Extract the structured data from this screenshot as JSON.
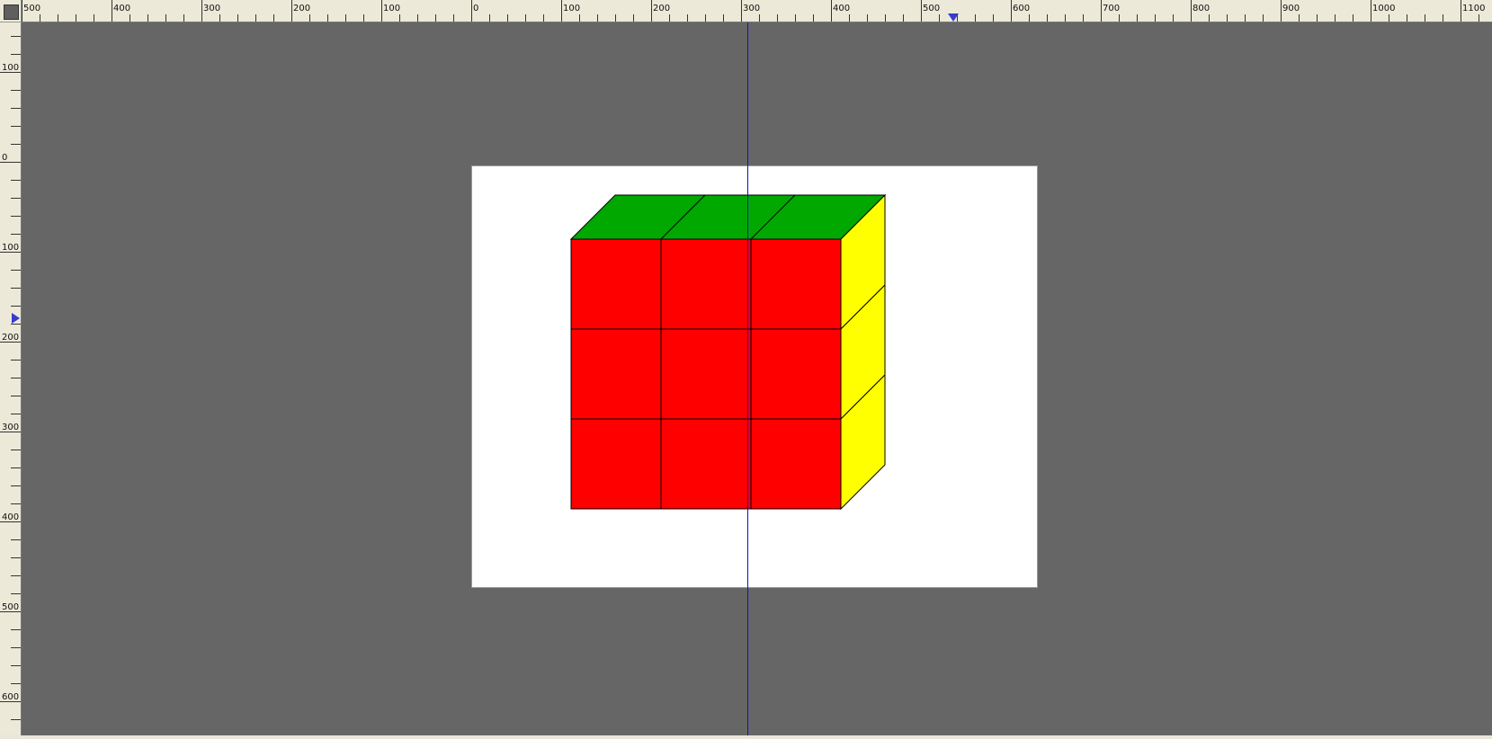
{
  "rulers": {
    "horizontal_labels": [
      "500",
      "400",
      "300",
      "200",
      "100",
      "0",
      "100",
      "200",
      "300",
      "400",
      "500",
      "600",
      "700",
      "800",
      "900",
      "1000",
      "1100"
    ],
    "vertical_labels": [
      "100",
      "0",
      "100",
      "200",
      "300",
      "400",
      "500",
      "600"
    ]
  },
  "cube": {
    "front_color": "#ff0000",
    "top_color": "#00a800",
    "side_color": "#ffff00",
    "edge_color": "#000000"
  },
  "guide_color": "#1010cc",
  "canvas_background": "#666666",
  "page_background": "#ffffff"
}
